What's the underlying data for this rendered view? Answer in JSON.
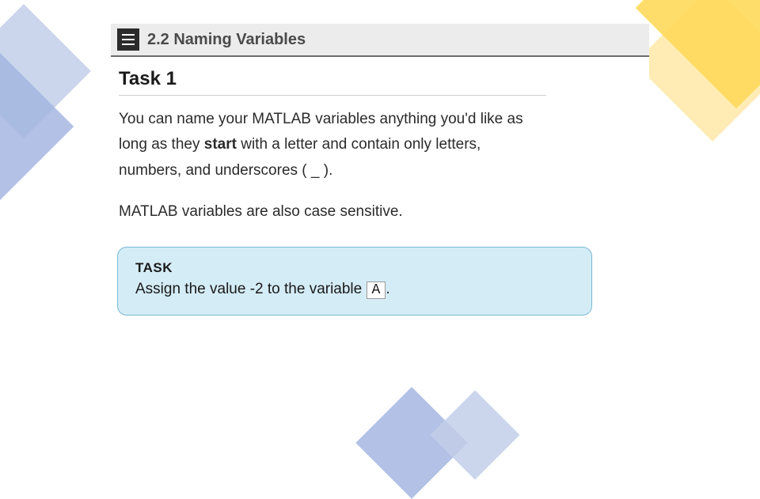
{
  "header": {
    "title": "2.2 Naming Variables"
  },
  "task": {
    "heading": "Task 1",
    "para1_a": "You can name your MATLAB variables anything you'd like as long as they ",
    "para1_bold": "start",
    "para1_b": " with a letter and contain only letters, numbers, and underscores ( _ ).",
    "para2": "MATLAB variables are also case sensitive.",
    "box_label": "TASK",
    "box_text_a": "Assign the value -2 to the variable ",
    "box_var": "A",
    "box_text_b": "."
  }
}
